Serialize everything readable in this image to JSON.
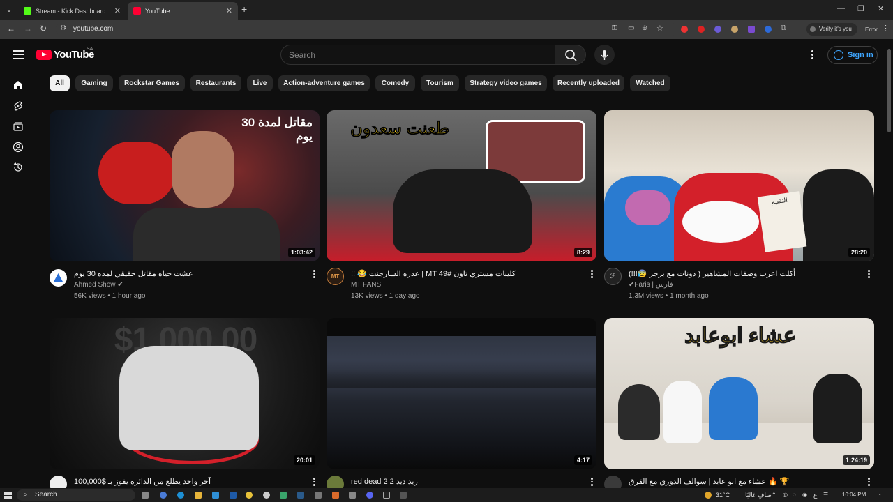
{
  "browser": {
    "tabs": [
      {
        "title": "Stream - Kick Dashboard",
        "color": "#53fc18"
      },
      {
        "title": "YouTube",
        "color": "#ff0033"
      }
    ],
    "url": "youtube.com",
    "profile_label": "Verify it's you",
    "error_label": "Error"
  },
  "youtube": {
    "logo_text": "YouTube",
    "country_code": "SA",
    "search_placeholder": "Search",
    "sign_in": "Sign in",
    "chips": [
      "All",
      "Gaming",
      "Rockstar Games",
      "Restaurants",
      "Live",
      "Action-adventure games",
      "Comedy",
      "Tourism",
      "Strategy video games",
      "Recently uploaded",
      "Watched"
    ],
    "videos": [
      {
        "title": "عشت حياه مقاتل حقيقي لمده 30 يوم",
        "channel": "Ahmed Show",
        "verified": true,
        "views": "56K views",
        "age": "1 hour ago",
        "duration": "1:03:42",
        "thumb_text": "مقاتل لمدة 30 يوم"
      },
      {
        "title": "!! 😂 عدره السارجنت | MT كليبات مستري تاون #49",
        "channel": "MT FANS",
        "verified": false,
        "views": "13K views",
        "age": "1 day ago",
        "duration": "8:29",
        "thumb_text": "طعنت سعدون"
      },
      {
        "title": "أكلت اعرب وصفات المشاهير ( دونات مع برجر 😰!!!)",
        "channel": "Faris | فارس",
        "verified": true,
        "views": "1.3M views",
        "age": "1 month ago",
        "duration": "28:20",
        "thumb_text": "التقييم"
      },
      {
        "title": "آخر واحد يطلع من الدائره يفوز بـ $100,000",
        "channel": "",
        "verified": false,
        "views": "",
        "age": "",
        "duration": "20:01",
        "thumb_text": "$1,000,00"
      },
      {
        "title": "red dead 2 ريد ديد 2",
        "channel": "",
        "verified": false,
        "views": "",
        "age": "",
        "duration": "4:17",
        "thumb_text": ""
      },
      {
        "title": "عشاء مع ابو عابد | سوالف الدوري مع القرق 🔥 🏆",
        "channel": "",
        "verified": false,
        "views": "",
        "age": "",
        "duration": "1:24:19",
        "thumb_text": "عشاء ابوعابد"
      }
    ]
  },
  "taskbar": {
    "search_label": "Search",
    "weather": "31°C",
    "weather_desc": "صافٍ غالبًا",
    "lang": "ع",
    "time": "10:04 PM"
  }
}
